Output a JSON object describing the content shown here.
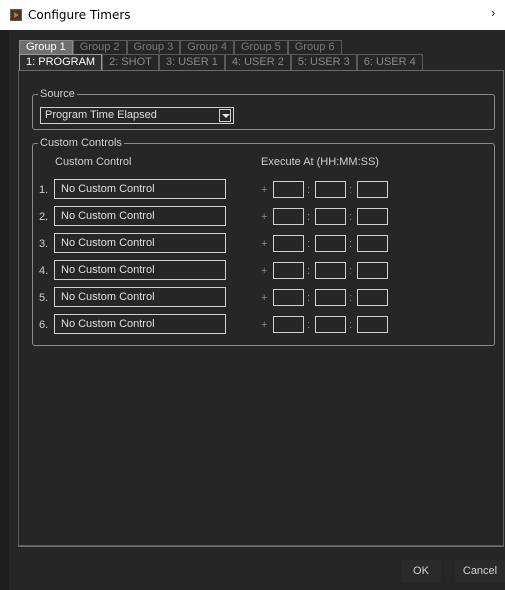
{
  "window": {
    "title": "Configure Timers",
    "close_glyph": "›"
  },
  "group_tabs": [
    "Group 1",
    "Group 2",
    "Group 3",
    "Group 4",
    "Group 5",
    "Group 6"
  ],
  "trigger_tabs": [
    "1: PROGRAM",
    "2: SHOT",
    "3: USER 1",
    "4: USER 2",
    "5: USER 3",
    "6: USER 4"
  ],
  "source": {
    "legend": "Source",
    "selected": "Program Time Elapsed"
  },
  "custom_controls": {
    "legend": "Custom Controls",
    "col_control": "Custom Control",
    "col_execute": "Execute At (HH:MM:SS)",
    "plus_glyph": "+",
    "colon_glyph": ":",
    "rows": [
      {
        "num": "1.",
        "control": "No Custom Control"
      },
      {
        "num": "2.",
        "control": "No Custom Control"
      },
      {
        "num": "3.",
        "control": "No Custom Control"
      },
      {
        "num": "4.",
        "control": "No Custom Control"
      },
      {
        "num": "5.",
        "control": "No Custom Control"
      },
      {
        "num": "6.",
        "control": "No Custom Control"
      }
    ]
  },
  "buttons": {
    "ok": "OK",
    "cancel": "Cancel"
  },
  "colors": {
    "background": "#262626",
    "active_tab": "#6e6e6e",
    "accent_icon": "#e06a1a"
  }
}
